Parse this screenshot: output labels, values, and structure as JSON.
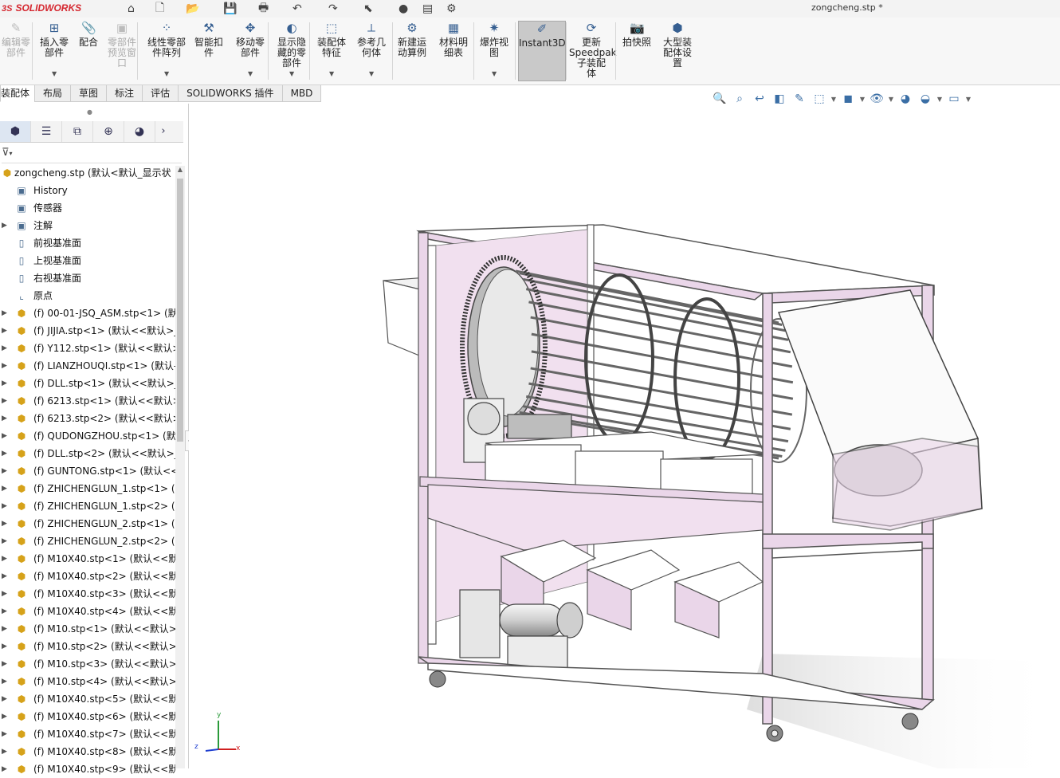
{
  "app": {
    "logo_mark": "3S",
    "logo_text": "SOLIDWORKS",
    "document_title": "zongcheng.stp *"
  },
  "quick_access": [
    {
      "name": "home-icon",
      "glyph": "⌂"
    },
    {
      "name": "new-document-icon",
      "glyph": "🗋"
    },
    {
      "name": "open-icon",
      "glyph": "📂"
    },
    {
      "name": "save-icon",
      "glyph": "💾"
    },
    {
      "name": "print-icon",
      "glyph": "🖶"
    },
    {
      "name": "undo-icon",
      "glyph": "↶"
    },
    {
      "name": "redo-icon",
      "glyph": "↷"
    },
    {
      "name": "select-icon",
      "glyph": "⬉"
    },
    {
      "name": "rebuild-icon",
      "glyph": "●"
    },
    {
      "name": "file-properties-icon",
      "glyph": "▤"
    },
    {
      "name": "options-icon",
      "glyph": "⚙"
    }
  ],
  "ribbon": {
    "buttons": [
      {
        "id": "edit-component",
        "label": "编辑零\n部件",
        "disabled": true,
        "icon": "✎"
      },
      {
        "id": "insert-component",
        "label": "插入零\n部件",
        "icon": "⊞"
      },
      {
        "id": "mate",
        "label": "配合",
        "icon": "📎"
      },
      {
        "id": "component-preview",
        "label": "零部件\n预览窗\n口",
        "disabled": true,
        "icon": "▣"
      },
      {
        "id": "linear-pattern",
        "label": "线性零部\n件阵列",
        "icon": "⁘"
      },
      {
        "id": "smart-fastener",
        "label": "智能扣\n件",
        "icon": "⚒"
      },
      {
        "id": "move-component",
        "label": "移动零\n部件",
        "icon": "✥"
      },
      {
        "id": "show-hidden",
        "label": "显示隐\n藏的零\n部件",
        "icon": "◐"
      },
      {
        "id": "assembly-features",
        "label": "装配体\n特征",
        "icon": "⬚"
      },
      {
        "id": "reference-geometry",
        "label": "参考几\n何体",
        "icon": "⟂"
      },
      {
        "id": "new-motion-study",
        "label": "新建运\n动算例",
        "icon": "⚙"
      },
      {
        "id": "bill-of-materials",
        "label": "材料明\n细表",
        "icon": "▦"
      },
      {
        "id": "exploded-view",
        "label": "爆炸视\n图",
        "icon": "✷"
      },
      {
        "id": "instant3d",
        "label": "Instant3D",
        "active": true,
        "icon": "✐"
      },
      {
        "id": "update-speedpak",
        "label": "更新\nSpeedpak\n子装配\n体",
        "icon": "⟳"
      },
      {
        "id": "take-snapshot",
        "label": "拍快照",
        "icon": "📷"
      },
      {
        "id": "large-assembly",
        "label": "大型装\n配体设\n置",
        "icon": "⬢"
      }
    ]
  },
  "tabs": [
    "装配体",
    "布局",
    "草图",
    "标注",
    "评估",
    "SOLIDWORKS 插件",
    "MBD"
  ],
  "feature_tree": {
    "root": "zongcheng.stp  (默认<默认_显示状",
    "items": [
      {
        "label": "History",
        "type": "feat",
        "expand": false
      },
      {
        "label": "传感器",
        "type": "feat",
        "expand": false
      },
      {
        "label": "注解",
        "type": "feat",
        "expand": true
      },
      {
        "label": "前视基准面",
        "type": "plane",
        "expand": false
      },
      {
        "label": "上视基准面",
        "type": "plane",
        "expand": false
      },
      {
        "label": "右视基准面",
        "type": "plane",
        "expand": false
      },
      {
        "label": "原点",
        "type": "origin",
        "expand": false
      },
      {
        "label": "(f) 00-01-JSQ_ASM.stp<1> (默",
        "type": "part",
        "expand": true
      },
      {
        "label": "(f) JIJIA.stp<1> (默认<<默认>_",
        "type": "part",
        "expand": true
      },
      {
        "label": "(f) Y112.stp<1> (默认<<默认>_",
        "type": "part",
        "expand": true
      },
      {
        "label": "(f) LIANZHOUQI.stp<1> (默认-",
        "type": "part",
        "expand": true
      },
      {
        "label": "(f) DLL.stp<1> (默认<<默认>_5",
        "type": "part",
        "expand": true
      },
      {
        "label": "(f) 6213.stp<1> (默认<<默认>_",
        "type": "part",
        "expand": true
      },
      {
        "label": "(f) 6213.stp<2> (默认<<默认>_",
        "type": "part",
        "expand": true
      },
      {
        "label": "(f) QUDONGZHOU.stp<1> (默",
        "type": "part",
        "expand": true
      },
      {
        "label": "(f) DLL.stp<2> (默认<<默认>_5",
        "type": "part",
        "expand": true
      },
      {
        "label": "(f) GUNTONG.stp<1> (默认<<",
        "type": "part",
        "expand": true
      },
      {
        "label": "(f) ZHICHENGLUN_1.stp<1> (默",
        "type": "part",
        "expand": true
      },
      {
        "label": "(f) ZHICHENGLUN_1.stp<2> (默",
        "type": "part",
        "expand": true
      },
      {
        "label": "(f) ZHICHENGLUN_2.stp<1> (默",
        "type": "part",
        "expand": true
      },
      {
        "label": "(f) ZHICHENGLUN_2.stp<2> (默",
        "type": "part",
        "expand": true
      },
      {
        "label": "(f) M10X40.stp<1> (默认<<默",
        "type": "part",
        "expand": true
      },
      {
        "label": "(f) M10X40.stp<2> (默认<<默",
        "type": "part",
        "expand": true
      },
      {
        "label": "(f) M10X40.stp<3> (默认<<默",
        "type": "part",
        "expand": true
      },
      {
        "label": "(f) M10X40.stp<4> (默认<<默",
        "type": "part",
        "expand": true
      },
      {
        "label": "(f) M10.stp<1> (默认<<默认>_",
        "type": "part",
        "expand": true
      },
      {
        "label": "(f) M10.stp<2> (默认<<默认>_",
        "type": "part",
        "expand": true
      },
      {
        "label": "(f) M10.stp<3> (默认<<默认>_",
        "type": "part",
        "expand": true
      },
      {
        "label": "(f) M10.stp<4> (默认<<默认>_",
        "type": "part",
        "expand": true
      },
      {
        "label": "(f) M10X40.stp<5> (默认<<默",
        "type": "part",
        "expand": true
      },
      {
        "label": "(f) M10X40.stp<6> (默认<<默",
        "type": "part",
        "expand": true
      },
      {
        "label": "(f) M10X40.stp<7> (默认<<默",
        "type": "part",
        "expand": true
      },
      {
        "label": "(f) M10X40.stp<8> (默认<<默",
        "type": "part",
        "expand": true
      },
      {
        "label": "(f) M10X40.stp<9> (默认<<默",
        "type": "part",
        "expand": true
      }
    ]
  },
  "triad": {
    "x": "x",
    "y": "y",
    "z": "z"
  },
  "colors": {
    "accent_red": "#d5272f",
    "frame_pink": "#f0d8ee",
    "frame_line": "#555555"
  }
}
